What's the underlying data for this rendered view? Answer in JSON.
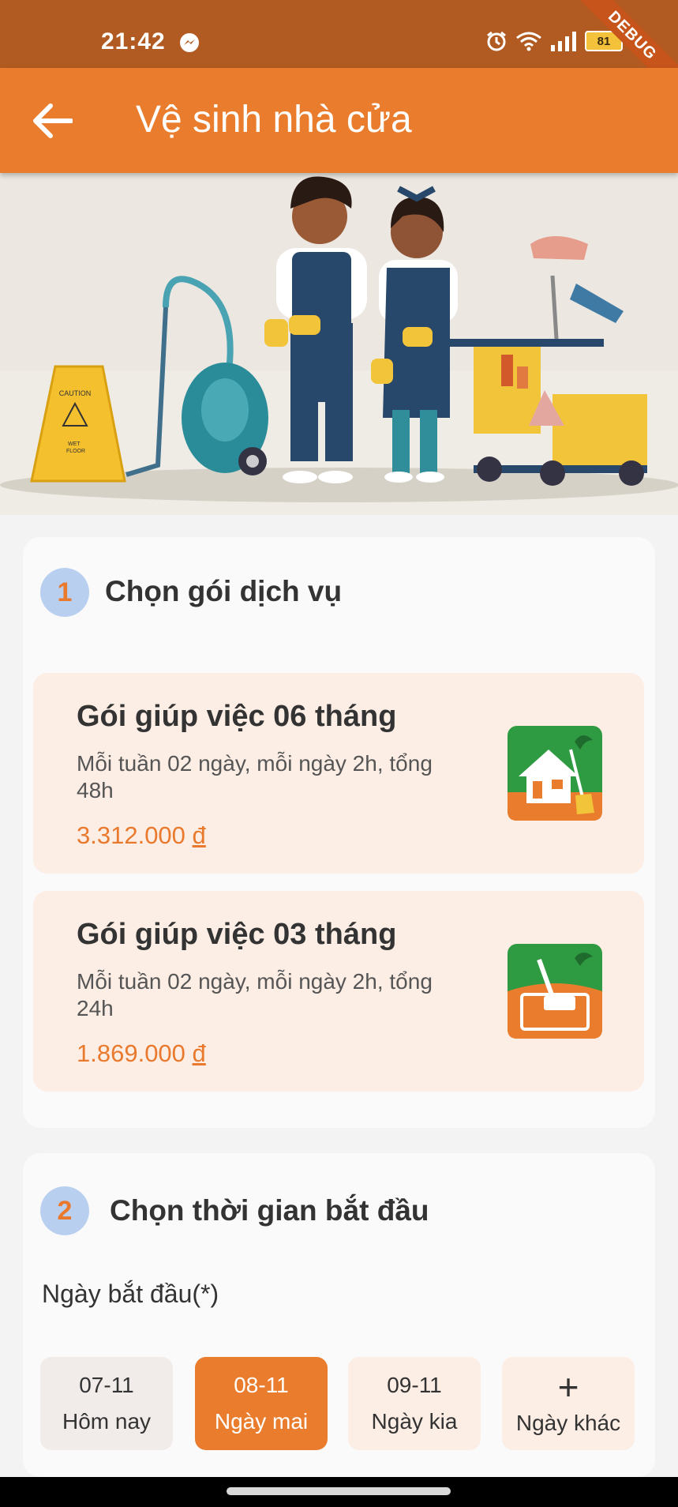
{
  "status_bar": {
    "time": "21:42",
    "battery": "81",
    "debug_label": "DEBUG",
    "icons": [
      "messenger-icon",
      "alarm-icon",
      "wifi-icon",
      "signal-icon",
      "battery-icon"
    ]
  },
  "app_bar": {
    "title": "Vệ sinh nhà cửa",
    "back_icon": "arrow-left-icon"
  },
  "banner": {
    "sign_text_1": "CAUTION",
    "sign_text_2": "WET",
    "sign_text_3": "FLOOR"
  },
  "section1": {
    "step": "1",
    "title": "Chọn gói dịch vụ",
    "packages": [
      {
        "name": "Gói giúp việc 06 tháng",
        "desc": "Mỗi tuần 02 ngày, mỗi ngày 2h, tổng 48h",
        "price": "3.312.000",
        "currency": "đ",
        "icon": "house-cleaning-icon"
      },
      {
        "name": "Gói giúp việc 03 tháng",
        "desc": "Mỗi tuần 02 ngày, mỗi ngày 2h, tổng 24h",
        "price": "1.869.000",
        "currency": "đ",
        "icon": "floor-cleaning-icon"
      }
    ]
  },
  "section2": {
    "step": "2",
    "title": "Chọn thời gian bắt đầu",
    "date_label": "Ngày bắt đầu(*)",
    "dates": [
      {
        "date": "07-11",
        "label": "Hôm nay"
      },
      {
        "date": "08-11",
        "label": "Ngày mai"
      },
      {
        "date": "09-11",
        "label": "Ngày kia"
      }
    ],
    "other_plus": "+",
    "other_label": "Ngày khác"
  },
  "colors": {
    "primary": "#ea7d2d",
    "status_bar": "#b15b22",
    "card_bg": "#fdeee5",
    "step_circle": "#b9cfef"
  }
}
